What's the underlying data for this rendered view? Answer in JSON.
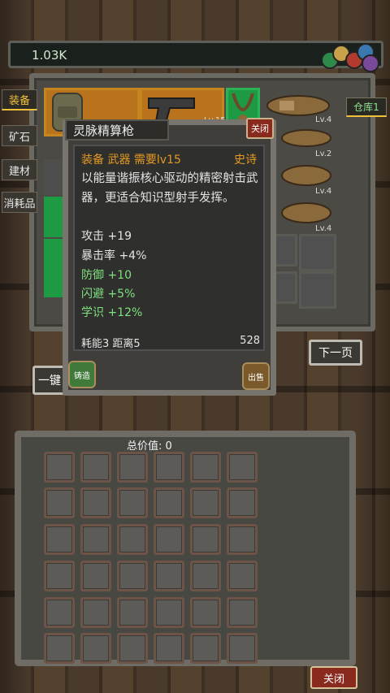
{
  "currency": {
    "amount": "1.03K"
  },
  "side_tabs": [
    {
      "label": "装备",
      "active": true
    },
    {
      "label": "矿石",
      "active": false
    },
    {
      "label": "建材",
      "active": false
    },
    {
      "label": "消耗品",
      "active": false
    }
  ],
  "storage_tab": {
    "label": "仓库1"
  },
  "item_levels": [
    "Lv.15",
    "Lv.4",
    "Lv.2",
    "Lv.4",
    "Lv.4"
  ],
  "dialog": {
    "title": "灵脉精算枪",
    "close_label": "关闭",
    "header": {
      "category": "装备",
      "type": "武器",
      "requirement": "需要lv15",
      "rarity": "史诗"
    },
    "description": "以能量谐振核心驱动的精密射击武器，更适合知识型射手发挥。",
    "stats": [
      {
        "text": "攻击 +19",
        "color": "white"
      },
      {
        "text": "暴击率 +4%",
        "color": "white"
      },
      {
        "text": "防御 +10",
        "color": "green"
      },
      {
        "text": "闪避 +5%",
        "color": "green"
      },
      {
        "text": "学识 +12%",
        "color": "green"
      }
    ],
    "energy": "耗能3",
    "range": "距离5",
    "value": "528",
    "forge_label": "铸造",
    "sell_label": "出售"
  },
  "next_page_label": "下一页",
  "left_button_label": "一键",
  "total_value_label": "总价值: 0",
  "close_label": "关闭",
  "colors": {
    "rarity": "#e39a23",
    "bonus": "#7fe07f",
    "close": "#8a2a1e",
    "active_tab": "#f0c03a"
  }
}
